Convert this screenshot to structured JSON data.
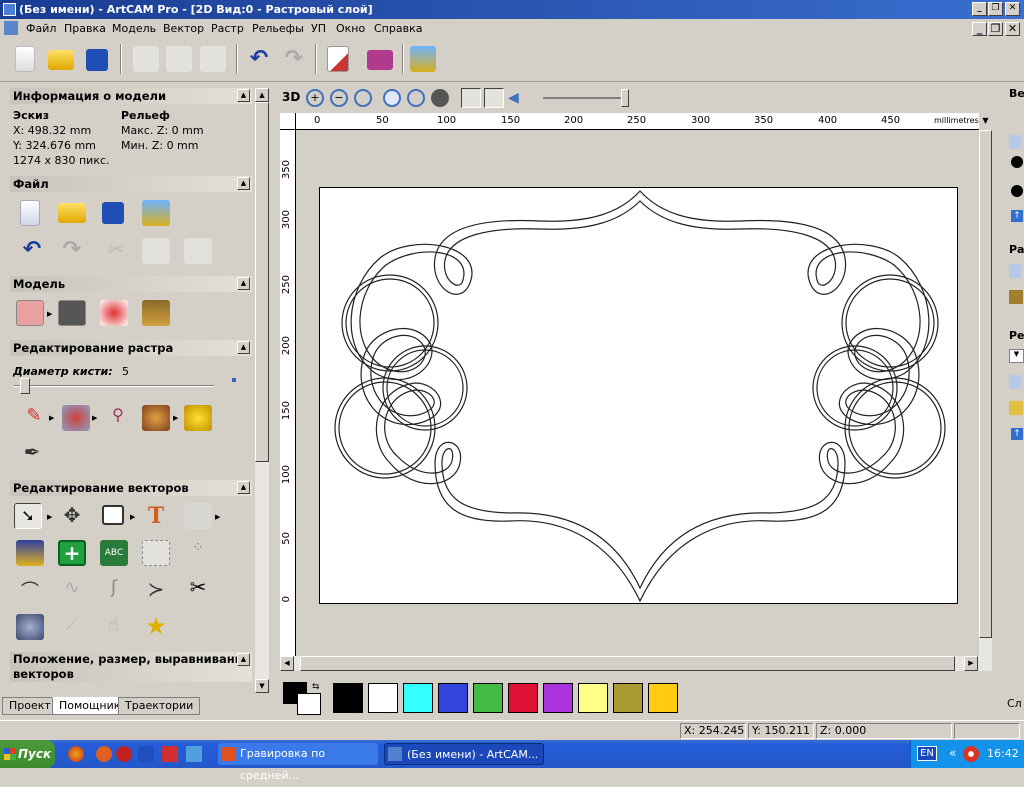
{
  "window": {
    "title": "(Без имени) - ArtCAM Pro - [2D Вид:0 - Растровый слой]"
  },
  "menu": [
    "Файл",
    "Правка",
    "Модель",
    "Вектор",
    "Растр",
    "Рельефы",
    "УП",
    "Окно",
    "Справка"
  ],
  "icons": {
    "new": "new-file-icon",
    "open": "folder-open-icon",
    "save": "save-icon",
    "cut": "cut-icon",
    "copy": "copy-icon",
    "paste": "paste-icon",
    "undo": "undo-icon",
    "redo": "redo-icon",
    "edit": "notepad-icon",
    "help": "book-icon",
    "import": "import-icon"
  },
  "panel": {
    "model_info": {
      "header": "Информация о модели",
      "sketch_label": "Эскиз",
      "relief_label": "Рельеф",
      "x": "X: 498.32 mm",
      "y": "Y: 324.676 mm",
      "pixels": "1274 x 830 пикс.",
      "max_z": "Макс. Z: 0 mm",
      "min_z": "Мин. Z: 0 mm"
    },
    "file": {
      "header": "Файл"
    },
    "model": {
      "header": "Модель"
    },
    "raster_edit": {
      "header": "Редактирование растра",
      "brush_label": "Диаметр кисти:",
      "brush_value": "5"
    },
    "vector_edit": {
      "header": "Редактирование векторов"
    },
    "position": {
      "header": "Положение, размер, выравнивание векторов"
    }
  },
  "tabs": [
    "Проект",
    "Помощник",
    "Траектории"
  ],
  "view_toolbar": {
    "mode_3d": "3D"
  },
  "ruler": {
    "unit": "millimetres",
    "top_ticks": [
      "0",
      "50",
      "100",
      "150",
      "200",
      "250",
      "300",
      "350",
      "400",
      "450"
    ],
    "left_ticks": [
      "350",
      "300",
      "250",
      "200",
      "150",
      "100",
      "50",
      "0"
    ]
  },
  "palette": {
    "primary": "#000000",
    "secondary": "#ffffff",
    "colors": [
      "#000000",
      "#ffffff",
      "#33ffff",
      "#3344dd",
      "#44bb44",
      "#dd1133",
      "#aa33dd",
      "#ffff88",
      "#aa9933",
      "#ffcc11"
    ]
  },
  "status": {
    "x": "X: 254.245",
    "y": "Y: 150.211",
    "z": "Z: 0.000"
  },
  "taskbar": {
    "start": "Пуск",
    "task1": "Гравировка по средней...",
    "task2": "(Без имени) - ArtCAM...",
    "lang": "EN",
    "time": "16:42"
  },
  "right_panel": {
    "label_ve": "Ве",
    "label_ra": "Ра",
    "label_re": "Ре",
    "label_sl": "Сл"
  }
}
